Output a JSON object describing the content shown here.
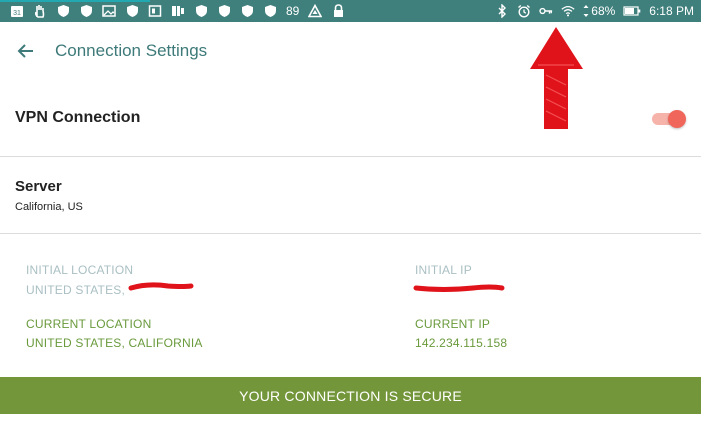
{
  "status_bar": {
    "notification_count": "31",
    "temperature": "89",
    "battery": "68%",
    "time": "6:18 PM"
  },
  "app_bar": {
    "title": "Connection Settings"
  },
  "vpn": {
    "label": "VPN Connection",
    "enabled": true
  },
  "server": {
    "label": "Server",
    "value": "California, US"
  },
  "info": {
    "initial_location_label": "INITIAL LOCATION",
    "initial_location_value": "UNITED STATES,",
    "initial_ip_label": "INITIAL IP",
    "current_location_label": "CURRENT LOCATION",
    "current_location_value": "UNITED STATES, CALIFORNIA",
    "current_ip_label": "CURRENT IP",
    "current_ip_value": "142.234.115.158"
  },
  "banner": {
    "text": "YOUR CONNECTION IS SECURE"
  },
  "colors": {
    "status_bar": "#3f7f7c",
    "title": "#3d7a79",
    "toggle_on": "#f0665a",
    "muted_label": "#a9bfc3",
    "green_label": "#6a9a3c",
    "banner": "#74963a",
    "annotation": "#e0131b"
  }
}
